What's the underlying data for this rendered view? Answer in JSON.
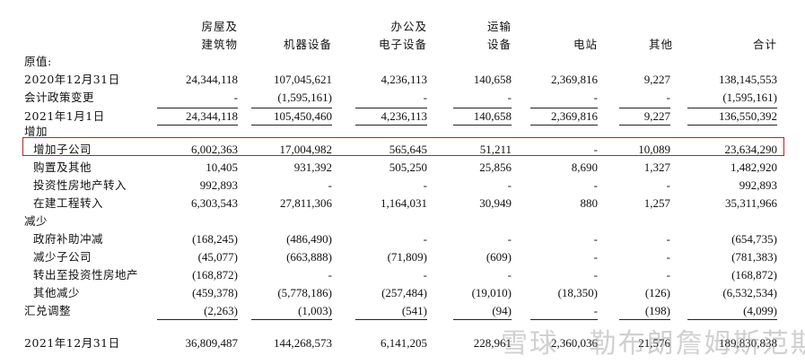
{
  "headers": {
    "c1": [
      "房屋及",
      "建筑物"
    ],
    "c2": [
      "机器设备"
    ],
    "c3": [
      "办公及",
      "电子设备"
    ],
    "c4": [
      "运输",
      "设备"
    ],
    "c5": [
      "电站"
    ],
    "c6": [
      "其他"
    ],
    "c7": [
      "合计"
    ]
  },
  "rows": [
    {
      "label": "原值:",
      "values": [
        "",
        "",
        "",
        "",
        "",
        "",
        ""
      ]
    },
    {
      "label": "2020年12月31日",
      "values": [
        "24,344,118",
        "107,045,621",
        "4,236,113",
        "140,658",
        "2,369,816",
        "9,227",
        "138,145,553"
      ]
    },
    {
      "label": "会计政策变更",
      "values": [
        "-",
        "(1,595,161)",
        "-",
        "-",
        "-",
        "-",
        "(1,595,161)"
      ]
    },
    {
      "label": "2021年1月1日",
      "values": [
        "24,344,118",
        "105,450,460",
        "4,236,113",
        "140,658",
        "2,369,816",
        "9,227",
        "136,550,392"
      ]
    },
    {
      "label": "增加",
      "values": [
        "",
        "",
        "",
        "",
        "",
        "",
        ""
      ]
    },
    {
      "label": "增加子公司",
      "values": [
        "6,002,363",
        "17,004,982",
        "565,645",
        "51,211",
        "-",
        "10,089",
        "23,634,290"
      ]
    },
    {
      "label": "购置及其他",
      "values": [
        "10,405",
        "931,392",
        "505,250",
        "25,856",
        "8,690",
        "1,327",
        "1,482,920"
      ]
    },
    {
      "label": "投资性房地产转入",
      "values": [
        "992,893",
        "-",
        "-",
        "-",
        "-",
        "-",
        "992,893"
      ]
    },
    {
      "label": "在建工程转入",
      "values": [
        "6,303,543",
        "27,811,306",
        "1,164,031",
        "30,949",
        "880",
        "1,257",
        "35,311,966"
      ]
    },
    {
      "label": "减少",
      "values": [
        "",
        "",
        "",
        "",
        "",
        "",
        ""
      ]
    },
    {
      "label": "政府补助冲减",
      "values": [
        "(168,245)",
        "(486,490)",
        "-",
        "-",
        "-",
        "-",
        "(654,735)"
      ]
    },
    {
      "label": "减少子公司",
      "values": [
        "(45,077)",
        "(663,888)",
        "(71,809)",
        "(609)",
        "-",
        "-",
        "(781,383)"
      ]
    },
    {
      "label": "转出至投资性房地产",
      "values": [
        "(168,872)",
        "-",
        "-",
        "-",
        "-",
        "-",
        "(168,872)"
      ]
    },
    {
      "label": "其他减少",
      "values": [
        "(459,378)",
        "(5,778,186)",
        "(257,484)",
        "(19,010)",
        "(18,350)",
        "(126)",
        "(6,532,534)"
      ]
    },
    {
      "label": "汇兑调整",
      "values": [
        "(2,263)",
        "(1,003)",
        "(541)",
        "(94)",
        "-",
        "(198)",
        "(4,099)"
      ]
    },
    {
      "label": "2021年12月31日",
      "values": [
        "36,809,487",
        "144,268,573",
        "6,141,205",
        "228,961",
        "2,360,036",
        "21,576",
        "189,830,838"
      ]
    }
  ],
  "watermark": "雪球 · 勒布朗詹姆斯范斯"
}
